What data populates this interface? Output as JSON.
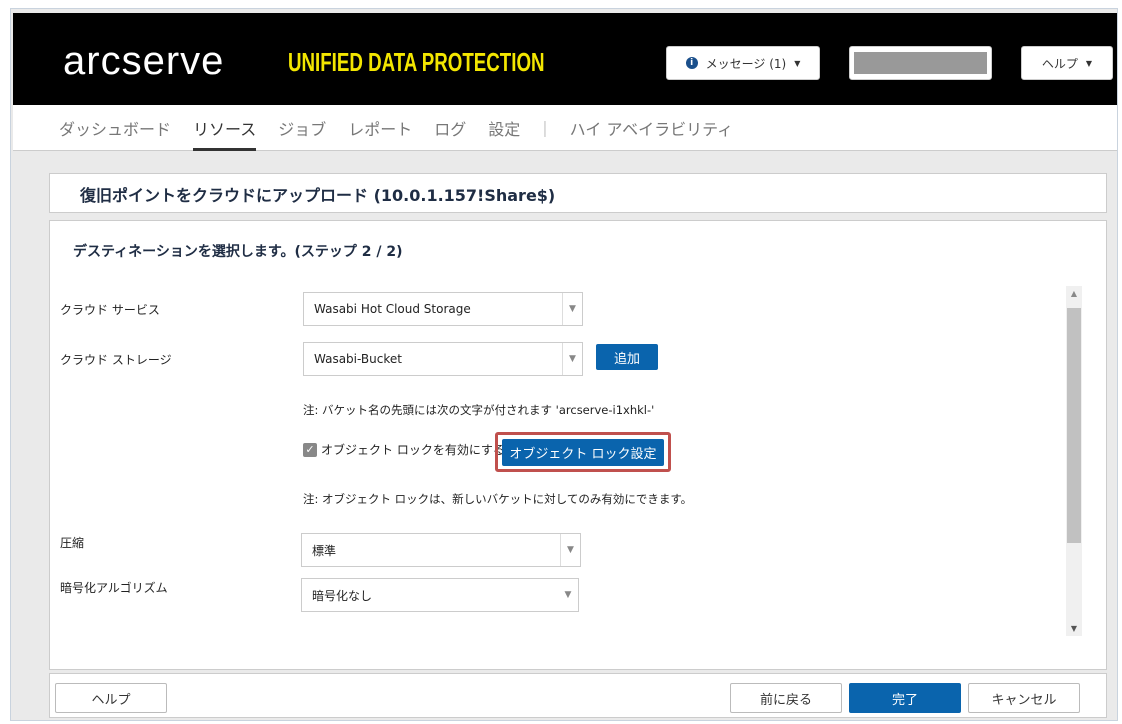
{
  "header": {
    "logo": "arcserve",
    "product": "UNIFIED DATA PROTECTION",
    "messages": "メッセージ (1)",
    "help": "ヘルプ"
  },
  "nav": [
    "ダッシュボード",
    "リソース",
    "ジョブ",
    "レポート",
    "ログ",
    "設定",
    "|",
    "ハイ アベイラビリティ"
  ],
  "title": "復旧ポイントをクラウドにアップロード (10.0.1.157!Share$)",
  "step": "デスティネーションを選択します。(ステップ 2 / 2)",
  "form": {
    "cloud_service_label": "クラウド サービス",
    "cloud_service": "Wasabi Hot Cloud Storage",
    "cloud_storage_label": "クラウド ストレージ",
    "cloud_storage": "Wasabi-Bucket",
    "add": "追加",
    "note1": "注: バケット名の先頭には次の文字が付されます 'arcserve-i1xhkl-'",
    "object_lock_check": "オブジェクト ロックを有効にする",
    "object_lock_checked": true,
    "object_lock_settings": "オブジェクト ロック設定",
    "note2": "注: オブジェクト ロックは、新しいバケットに対してのみ有効にできます。",
    "compression_label": "圧縮",
    "compression": "標準",
    "encryption_label": "暗号化アルゴリズム",
    "encryption": "暗号化なし"
  },
  "footer": {
    "help": "ヘルプ",
    "back": "前に戻る",
    "finish": "完了",
    "cancel": "キャンセル"
  }
}
